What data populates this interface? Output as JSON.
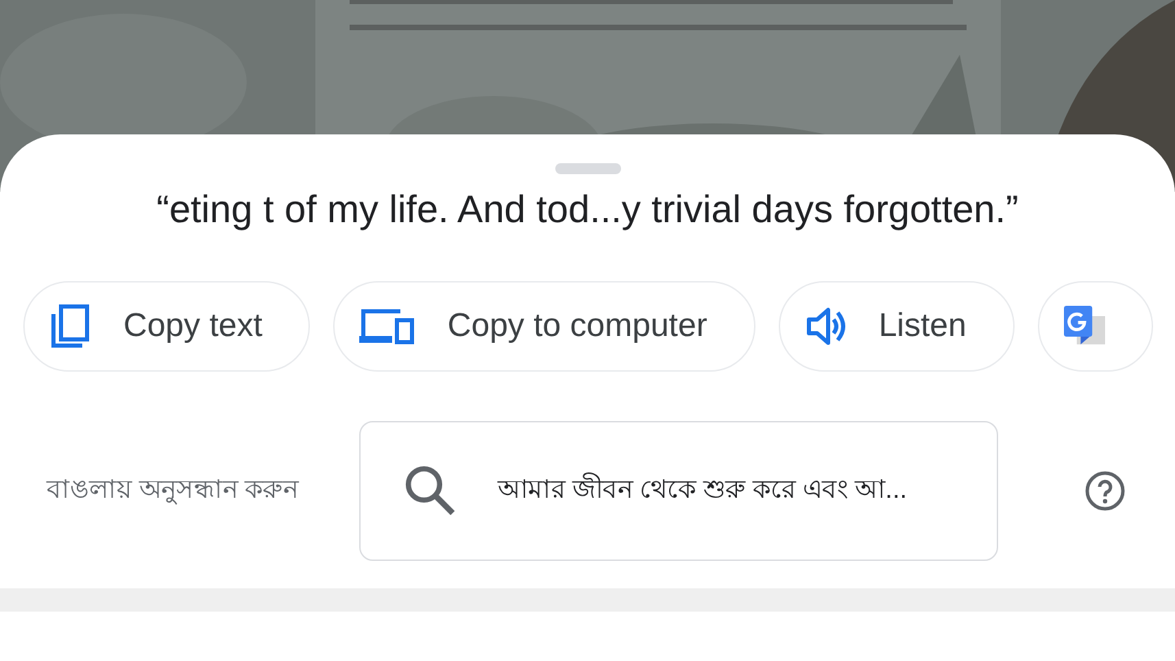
{
  "sheet": {
    "quote": "“eting t of my life. And tod...y trivial days forgotten.”",
    "actions": [
      {
        "kind": "copy",
        "label": "Copy text"
      },
      {
        "kind": "computer",
        "label": "Copy to computer"
      },
      {
        "kind": "listen",
        "label": "Listen"
      },
      {
        "kind": "translate"
      }
    ],
    "search": {
      "label": "বাঙলায় অনুসন্ধান করুন",
      "value": "আমার জীবন থেকে শুরু করে এবং আ..."
    }
  }
}
